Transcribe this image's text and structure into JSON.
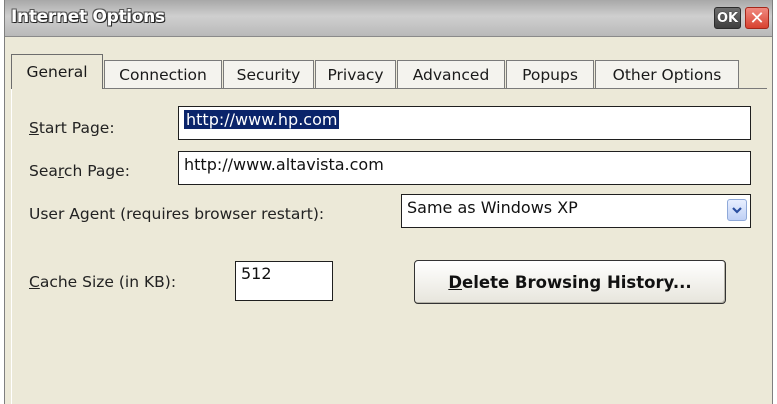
{
  "window": {
    "title": "Internet Options",
    "ok_label": "OK",
    "close_label": "✕"
  },
  "tabs": [
    {
      "label": "General",
      "active": true
    },
    {
      "label": "Connection",
      "active": false
    },
    {
      "label": "Security",
      "active": false
    },
    {
      "label": "Privacy",
      "active": false
    },
    {
      "label": "Advanced",
      "active": false
    },
    {
      "label": "Popups",
      "active": false
    },
    {
      "label": "Other Options",
      "active": false
    }
  ],
  "general": {
    "start_page": {
      "label": "Start Page:",
      "accesskey": "S",
      "label_rest": "tart Page:",
      "value": "http://www.hp.com"
    },
    "search_page": {
      "label": "Search Page:",
      "label_before": "Sea",
      "accesskey": "r",
      "label_rest": "ch Page:",
      "value": "http://www.altavista.com"
    },
    "user_agent": {
      "label": "User Agent (requires browser restart):",
      "value": "Same as Windows XP"
    },
    "cache_size": {
      "label": "Cache Size (in KB):",
      "accesskey": "C",
      "label_rest": "ache Size (in KB):",
      "value": "512"
    },
    "delete_history": {
      "label": "Delete Browsing History...",
      "accesskey": "D",
      "label_rest": "elete Browsing History..."
    }
  },
  "icons": {
    "select_arrow": "chevron-down-icon",
    "close": "close-icon"
  }
}
